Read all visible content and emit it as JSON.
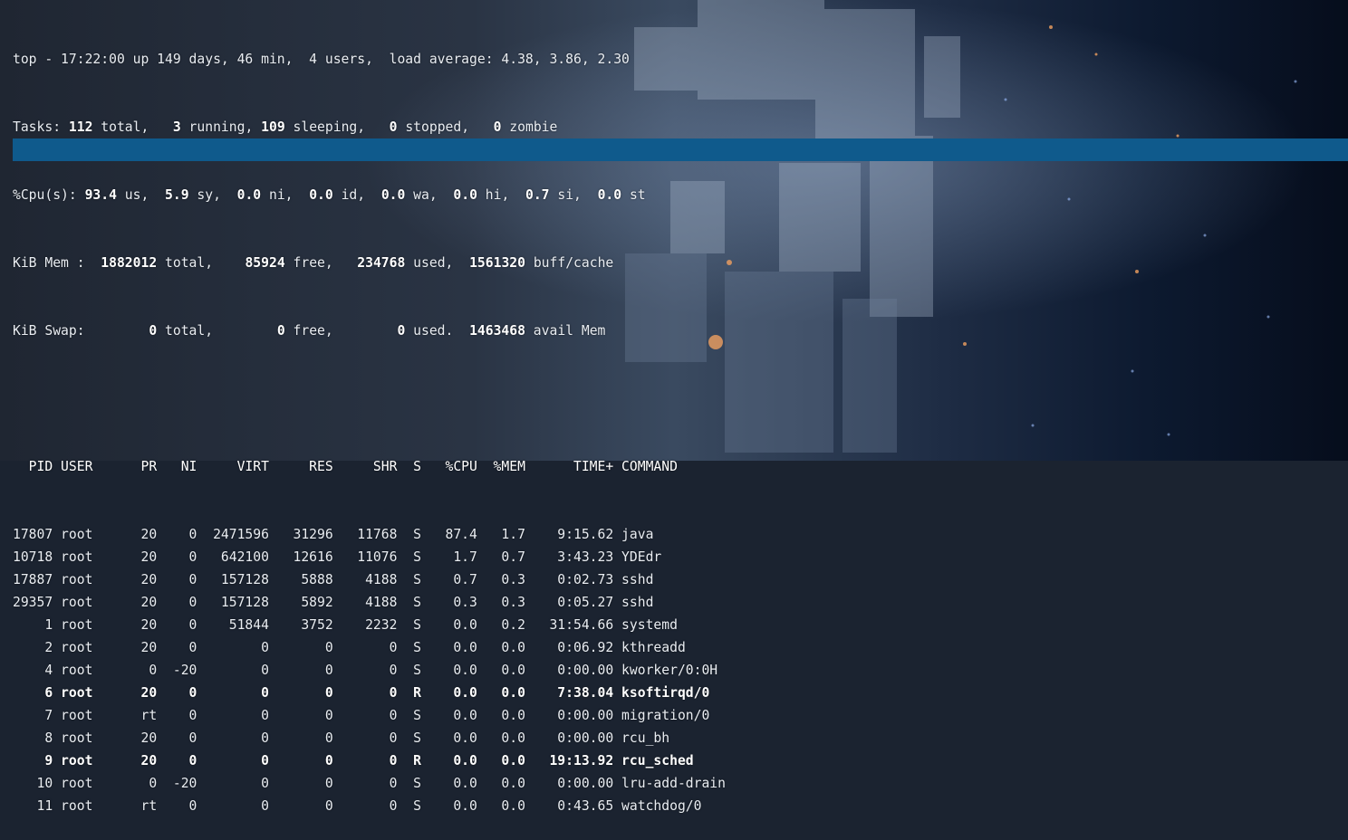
{
  "summary": {
    "uptime_line": "top - 17:22:00 up 149 days, 46 min,  4 users,  load average: 4.38, 3.86, 2.30",
    "tasks": {
      "label": "Tasks:",
      "total": "112",
      "running": "3",
      "sleeping": "109",
      "stopped": "0",
      "zombie": "0"
    },
    "cpu": {
      "label": "%Cpu(s):",
      "us": "93.4",
      "sy": "5.9",
      "ni": "0.0",
      "id": "0.0",
      "wa": "0.0",
      "hi": "0.0",
      "si": "0.7",
      "st": "0.0"
    },
    "mem": {
      "label": "KiB Mem :",
      "total": "1882012",
      "free": "85924",
      "used": "234768",
      "buff_cache": "1561320"
    },
    "swap": {
      "label": "KiB Swap:",
      "total": "0",
      "free": "0",
      "used": "0",
      "avail_mem": "1463468"
    }
  },
  "table": {
    "columns": [
      "PID",
      "USER",
      "PR",
      "NI",
      "VIRT",
      "RES",
      "SHR",
      "S",
      "%CPU",
      "%MEM",
      "TIME+",
      "COMMAND"
    ],
    "rows": [
      {
        "pid": "17807",
        "user": "root",
        "pr": "20",
        "ni": "0",
        "virt": "2471596",
        "res": "31296",
        "shr": "11768",
        "s": "S",
        "cpu": "87.4",
        "mem": "1.7",
        "time": "9:15.62",
        "command": "java",
        "bold": false
      },
      {
        "pid": "10718",
        "user": "root",
        "pr": "20",
        "ni": "0",
        "virt": "642100",
        "res": "12616",
        "shr": "11076",
        "s": "S",
        "cpu": "1.7",
        "mem": "0.7",
        "time": "3:43.23",
        "command": "YDEdr",
        "bold": false
      },
      {
        "pid": "17887",
        "user": "root",
        "pr": "20",
        "ni": "0",
        "virt": "157128",
        "res": "5888",
        "shr": "4188",
        "s": "S",
        "cpu": "0.7",
        "mem": "0.3",
        "time": "0:02.73",
        "command": "sshd",
        "bold": false
      },
      {
        "pid": "29357",
        "user": "root",
        "pr": "20",
        "ni": "0",
        "virt": "157128",
        "res": "5892",
        "shr": "4188",
        "s": "S",
        "cpu": "0.3",
        "mem": "0.3",
        "time": "0:05.27",
        "command": "sshd",
        "bold": false
      },
      {
        "pid": "1",
        "user": "root",
        "pr": "20",
        "ni": "0",
        "virt": "51844",
        "res": "3752",
        "shr": "2232",
        "s": "S",
        "cpu": "0.0",
        "mem": "0.2",
        "time": "31:54.66",
        "command": "systemd",
        "bold": false
      },
      {
        "pid": "2",
        "user": "root",
        "pr": "20",
        "ni": "0",
        "virt": "0",
        "res": "0",
        "shr": "0",
        "s": "S",
        "cpu": "0.0",
        "mem": "0.0",
        "time": "0:06.92",
        "command": "kthreadd",
        "bold": false
      },
      {
        "pid": "4",
        "user": "root",
        "pr": "0",
        "ni": "-20",
        "virt": "0",
        "res": "0",
        "shr": "0",
        "s": "S",
        "cpu": "0.0",
        "mem": "0.0",
        "time": "0:00.00",
        "command": "kworker/0:0H",
        "bold": false
      },
      {
        "pid": "6",
        "user": "root",
        "pr": "20",
        "ni": "0",
        "virt": "0",
        "res": "0",
        "shr": "0",
        "s": "R",
        "cpu": "0.0",
        "mem": "0.0",
        "time": "7:38.04",
        "command": "ksoftirqd/0",
        "bold": true
      },
      {
        "pid": "7",
        "user": "root",
        "pr": "rt",
        "ni": "0",
        "virt": "0",
        "res": "0",
        "shr": "0",
        "s": "S",
        "cpu": "0.0",
        "mem": "0.0",
        "time": "0:00.00",
        "command": "migration/0",
        "bold": false
      },
      {
        "pid": "8",
        "user": "root",
        "pr": "20",
        "ni": "0",
        "virt": "0",
        "res": "0",
        "shr": "0",
        "s": "S",
        "cpu": "0.0",
        "mem": "0.0",
        "time": "0:00.00",
        "command": "rcu_bh",
        "bold": false
      },
      {
        "pid": "9",
        "user": "root",
        "pr": "20",
        "ni": "0",
        "virt": "0",
        "res": "0",
        "shr": "0",
        "s": "R",
        "cpu": "0.0",
        "mem": "0.0",
        "time": "19:13.92",
        "command": "rcu_sched",
        "bold": true
      },
      {
        "pid": "10",
        "user": "root",
        "pr": "0",
        "ni": "-20",
        "virt": "0",
        "res": "0",
        "shr": "0",
        "s": "S",
        "cpu": "0.0",
        "mem": "0.0",
        "time": "0:00.00",
        "command": "lru-add-drain",
        "bold": false
      },
      {
        "pid": "11",
        "user": "root",
        "pr": "rt",
        "ni": "0",
        "virt": "0",
        "res": "0",
        "shr": "0",
        "s": "S",
        "cpu": "0.0",
        "mem": "0.0",
        "time": "0:43.65",
        "command": "watchdog/0",
        "bold": false
      }
    ]
  },
  "colors": {
    "header_bar": "#0f5a8c",
    "text": "#e9edf2",
    "bold_text": "#ffffff"
  }
}
